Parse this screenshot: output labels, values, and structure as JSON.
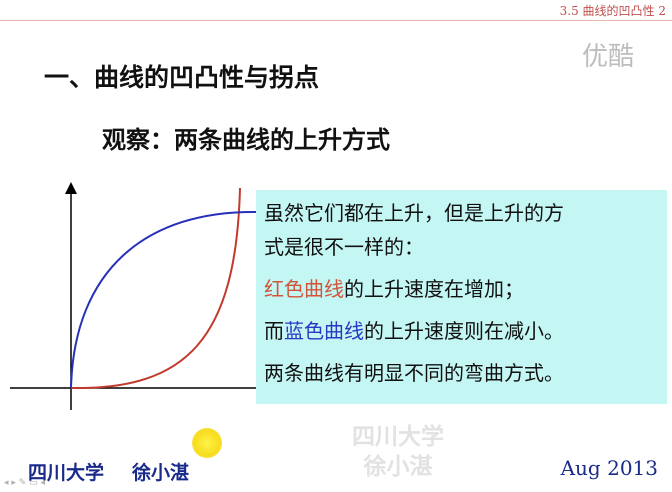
{
  "header": {
    "title": "3.5 曲线的凹凸性 2"
  },
  "watermark_top": "优酷",
  "section_title": "一、曲线的凹凸性与拐点",
  "subtitle": "观察：两条曲线的上升方式",
  "textbox": {
    "line1": "虽然它们都在上升，但是上升的方",
    "line2": "式是很不一样的：",
    "red_label": "红色曲线",
    "red_rest": "的上升速度在增加；",
    "blue_prefix": "而",
    "blue_label": "蓝色曲线",
    "blue_rest": "的上升速度则在减小。",
    "line5": "两条曲线有明显不同的弯曲方式。"
  },
  "watermark_bottom": {
    "line1": "四川大学",
    "line2": "徐小湛"
  },
  "footer": {
    "university": "四川大学",
    "author": "徐小湛",
    "date": "Aug 2013"
  },
  "nav_controls": "◂ ▸ ✎ ▭ ◂",
  "colors": {
    "red_curve": "#c23a2c",
    "blue_curve": "#2630b8",
    "text_box_bg": "#c4f6f4",
    "header_accent": "#c0504d"
  }
}
